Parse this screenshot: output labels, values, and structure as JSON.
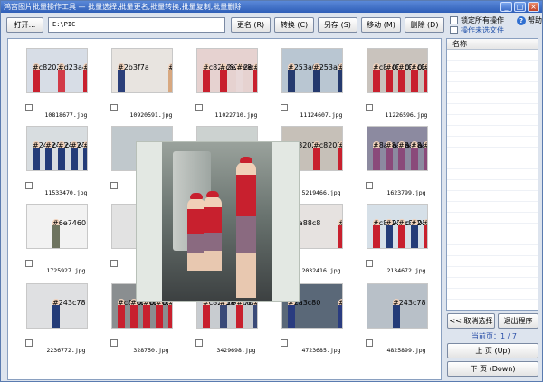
{
  "window": {
    "title": "鸿宫图片批量操作工具 — 批量选择,批量更名,批量转换,批量复制,批量删除...",
    "minimize": "_",
    "maximize": "□",
    "close": "×"
  },
  "toolbar": {
    "open_label": "打开...",
    "path_value": "E:\\PIC",
    "rename_label": "更名 (R)",
    "convert_label": "转换 (C)",
    "saveas_label": "另存 (S)",
    "move_label": "移动 (M)",
    "delete_label": "删除 (D)"
  },
  "options": {
    "lock_all": "锁定所有操作",
    "operate_unselected": "操作未选文件",
    "help": "帮助"
  },
  "files": [
    {
      "name": "10818677.jpg",
      "bg": "#d7dde6",
      "figs": [
        "#c8202e",
        "#d23a48",
        "#c8202e"
      ]
    },
    {
      "name": "10920591.jpg",
      "bg": "#e8e4e0",
      "figs": [
        "#2b3f7a",
        "#d8a880"
      ]
    },
    {
      "name": "11022710.jpg",
      "bg": "#e6d2d0",
      "figs": [
        "#c8202e",
        "#c8202e",
        "#e8d8d8",
        "#c8202e"
      ]
    },
    {
      "name": "11124607.jpg",
      "bg": "#b9c6d2",
      "figs": [
        "#253a6e",
        "#253a6e",
        "#253a6e"
      ]
    },
    {
      "name": "11226596.jpg",
      "bg": "#c9c3bd",
      "figs": [
        "#c8202e",
        "#c8202e",
        "#c8202e",
        "#c8202e",
        "#c8202e"
      ]
    },
    {
      "name": "11533470.jpg",
      "bg": "#d8dde0",
      "figs": [
        "#243c78",
        "#243c78",
        "#243c78",
        "#243c78",
        "#243c78"
      ]
    },
    {
      "name": "12065...",
      "bg": "#c0c8cc",
      "figs": [
        "#c8202e"
      ]
    },
    {
      "name": "",
      "bg": "#ccd2d0",
      "figs": []
    },
    {
      "name": "5219466.jpg",
      "bg": "#c6c0b8",
      "figs": [
        "#c8202e",
        "#c8202e",
        "#c8202e"
      ]
    },
    {
      "name": "1623799.jpg",
      "bg": "#8c8aa0",
      "figs": [
        "#8a4a7a",
        "#8a4a7a",
        "#8a4a7a",
        "#8a4a7a",
        "#8a4a7a"
      ]
    },
    {
      "name": "1725927.jpg",
      "bg": "#f2f2f2",
      "figs": [
        "#6e7460"
      ]
    },
    {
      "name": "182...",
      "bg": "#e2e2e2",
      "figs": [
        "#c8202e"
      ]
    },
    {
      "name": "",
      "bg": "#dcdcdc",
      "figs": []
    },
    {
      "name": "2032416.jpg",
      "bg": "#e6e2e0",
      "figs": [
        "#6a88c8",
        "#c8202e"
      ]
    },
    {
      "name": "2134672.jpg",
      "bg": "#d6e0e8",
      "figs": [
        "#c8202e",
        "#243c78",
        "#c8202e",
        "#243c78",
        "#c8202e"
      ]
    },
    {
      "name": "2236772.jpg",
      "bg": "#dfe0e2",
      "figs": [
        "#243c78"
      ]
    },
    {
      "name": "328750.jpg",
      "bg": "#8a8e90",
      "figs": [
        "#c8202e",
        "#c8202e",
        "#c8202e",
        "#c8202e",
        "#c8202e"
      ]
    },
    {
      "name": "3429698.jpg",
      "bg": "#c8ccd0",
      "figs": [
        "#c8202e",
        "#3a4a78",
        "#c8202e",
        "#3a4a78"
      ]
    },
    {
      "name": "4723685.jpg",
      "bg": "#5a6878",
      "figs": [
        "#2a3c80",
        "#2a3c80"
      ]
    },
    {
      "name": "4825899.jpg",
      "bg": "#b8c0c8",
      "figs": [
        "#243c78"
      ]
    }
  ],
  "sidebar": {
    "column_header": "名称",
    "cancel_select": "<< 取消选择",
    "exit": "退出程序",
    "page_label": "当前页：1 / 7",
    "prev_page": "上  页 (Up)",
    "next_page": "下  页 (Down)"
  }
}
